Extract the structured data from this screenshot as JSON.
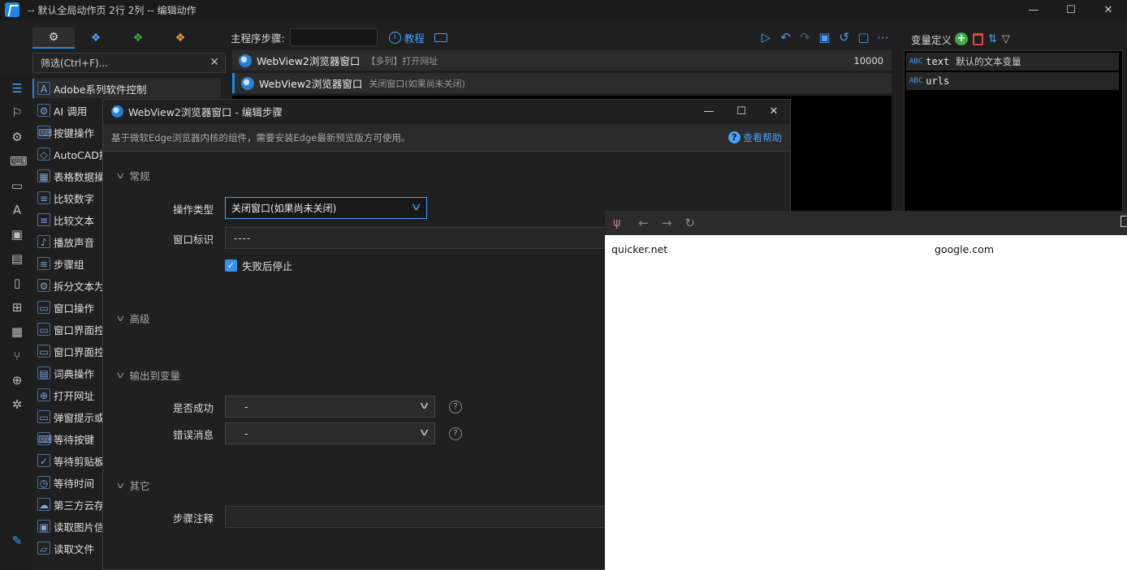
{
  "window": {
    "title": "-- 默认全局动作页 2行 2列 -- 编辑动作"
  },
  "window_controls": {
    "minimize": "—",
    "maximize": "☐",
    "close": "✕"
  },
  "filter": {
    "placeholder": "筛选(Ctrl+F)..."
  },
  "categories": [
    {
      "label": "Adobe系列软件控制",
      "icon": "adobe-icon"
    },
    {
      "label": "AI 调用",
      "icon": "gear-icon"
    },
    {
      "label": "按键操作",
      "icon": "keyboard-icon"
    },
    {
      "label": "AutoCAD控",
      "icon": "autocad-icon"
    },
    {
      "label": "表格数据操",
      "icon": "table-icon"
    },
    {
      "label": "比较数字",
      "icon": "compare-icon"
    },
    {
      "label": "比较文本",
      "icon": "compare-icon"
    },
    {
      "label": "播放声音",
      "icon": "sound-icon"
    },
    {
      "label": "步骤组",
      "icon": "layers-icon"
    },
    {
      "label": "拆分文本为",
      "icon": "gear-icon"
    },
    {
      "label": "窗口操作",
      "icon": "window-icon"
    },
    {
      "label": "窗口界面控",
      "icon": "window-icon"
    },
    {
      "label": "窗口界面控",
      "icon": "window-icon"
    },
    {
      "label": "词典操作",
      "icon": "dict-icon"
    },
    {
      "label": "打开网址",
      "icon": "globe-icon"
    },
    {
      "label": "弹窗提示或",
      "icon": "popup-icon"
    },
    {
      "label": "等待按键",
      "icon": "keyboard-icon"
    },
    {
      "label": "等待剪贴板",
      "icon": "clipboard-icon"
    },
    {
      "label": "等待时间",
      "icon": "timer-icon"
    },
    {
      "label": "第三方云存",
      "icon": "cloud-icon"
    },
    {
      "label": "读取图片信",
      "icon": "image-icon"
    },
    {
      "label": "读取文件",
      "icon": "folder-icon"
    }
  ],
  "steps_header": {
    "label": "主程序步骤:",
    "tutorial": "教程"
  },
  "steps": [
    {
      "name": "WebView2浏览器窗口",
      "desc": "【多列】打开网址",
      "num": "10000"
    },
    {
      "name": "WebView2浏览器窗口",
      "desc": "关闭窗口(如果尚未关闭)",
      "num": ""
    }
  ],
  "variables": {
    "title": "变量定义",
    "items": [
      {
        "type": "ABC",
        "name": "text",
        "desc": "默认的文本变量"
      },
      {
        "type": "ABC",
        "name": "urls",
        "desc": ""
      }
    ]
  },
  "dialog": {
    "title": "WebView2浏览器窗口 - 编辑步骤",
    "info": "基于微软Edge浏览器内核的组件，需要安装Edge最新预览版方可使用。",
    "help": "查看帮助",
    "sections": {
      "general": "常规",
      "advanced": "高级",
      "output": "输出到变量",
      "other": "其它"
    },
    "fields": {
      "op_type_label": "操作类型",
      "op_type_value": "关闭窗口(如果尚未关闭)",
      "window_id_label": "窗口标识",
      "window_id_value": "----",
      "stop_on_fail": "失败后停止",
      "success_label": "是否成功",
      "success_value": "-",
      "error_label": "错误消息",
      "error_value": "-",
      "note_label": "步骤注释"
    }
  },
  "browser": {
    "links": [
      "quicker.net",
      "google.com"
    ]
  },
  "colors": {
    "accent": "#1e88e5",
    "link": "#4a9ff5",
    "add": "#3daa4a",
    "delete": "#e04848"
  }
}
